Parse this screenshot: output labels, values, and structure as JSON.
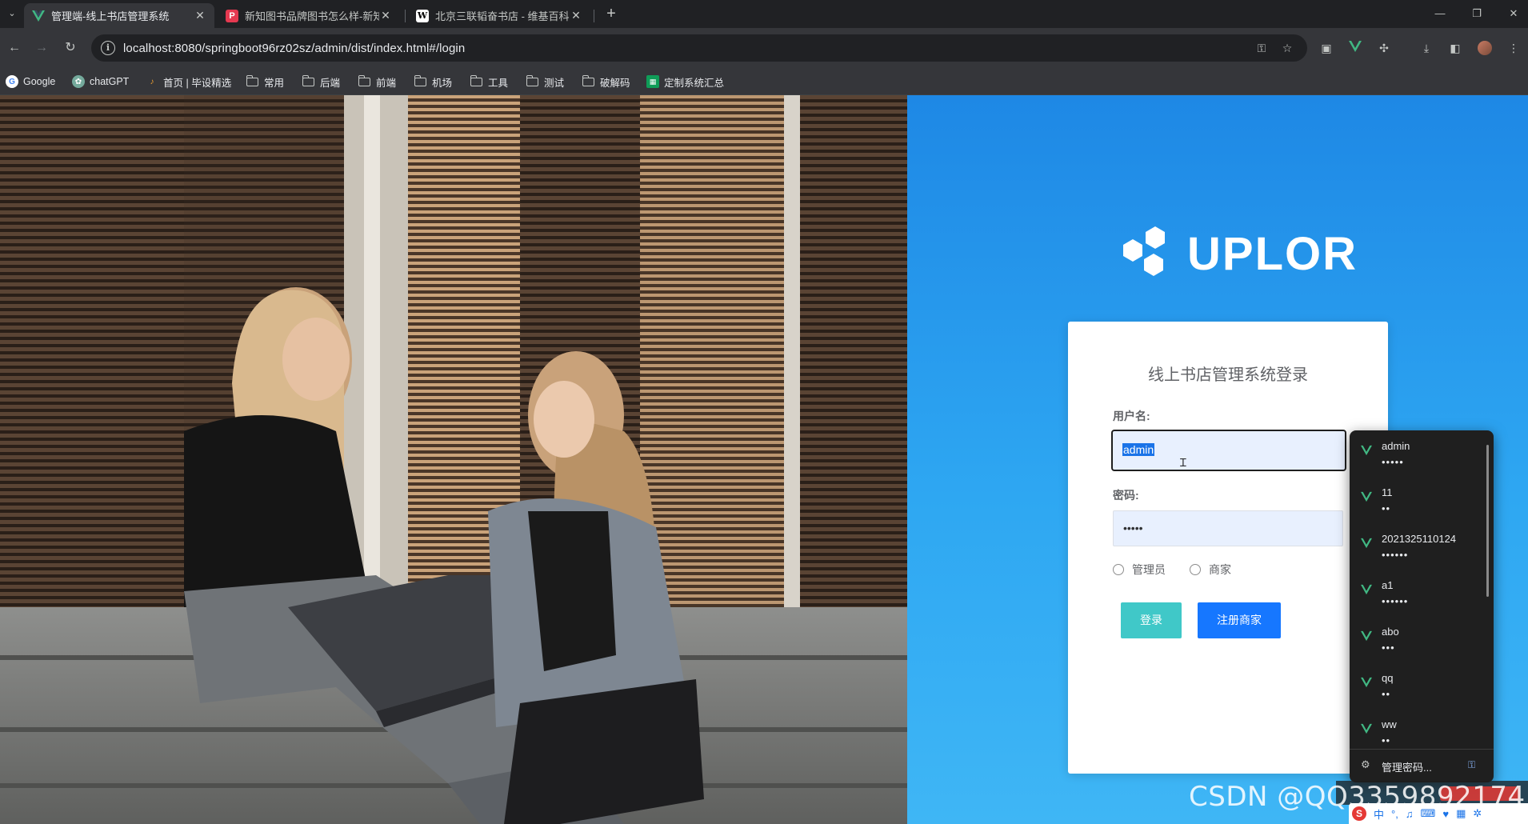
{
  "tabs": [
    {
      "title": "管理端-线上书店管理系统",
      "icon": "vue-v-icon",
      "active": true
    },
    {
      "title": "新知图书品牌图书怎么样-新知",
      "icon": "p-icon",
      "active": false
    },
    {
      "title": "北京三联韬奋书店 - 维基百科,",
      "icon": "w-icon",
      "active": false
    }
  ],
  "toolbar": {
    "url": "localhost:8080/springboot96rz02sz/admin/dist/index.html#/login"
  },
  "bookmarks": [
    {
      "label": "Google",
      "icon": "google-icon"
    },
    {
      "label": "chatGPT",
      "icon": "chatgpt-icon"
    },
    {
      "label": "首页 | 毕设精选",
      "icon": "site-icon"
    },
    {
      "label": "常用",
      "icon": "folder-icon"
    },
    {
      "label": "后端",
      "icon": "folder-icon"
    },
    {
      "label": "前端",
      "icon": "folder-icon"
    },
    {
      "label": "机场",
      "icon": "folder-icon"
    },
    {
      "label": "工具",
      "icon": "folder-icon"
    },
    {
      "label": "测试",
      "icon": "folder-icon"
    },
    {
      "label": "破解码",
      "icon": "folder-icon"
    },
    {
      "label": "定制系统汇总",
      "icon": "sheet-icon"
    }
  ],
  "logo": {
    "text": "UPLOR"
  },
  "login": {
    "title": "线上书店管理系统登录",
    "username_label": "用户名:",
    "username_value": "admin",
    "password_label": "密码:",
    "password_value": "•••••",
    "roles": [
      "管理员",
      "商家"
    ],
    "login_button": "登录",
    "register_button": "注册商家"
  },
  "autofill": {
    "items": [
      {
        "user": "admin",
        "pass": "•••••"
      },
      {
        "user": "11",
        "pass": "••"
      },
      {
        "user": "2021325110124",
        "pass": "••••••"
      },
      {
        "user": "a1",
        "pass": "••••••"
      },
      {
        "user": "abo",
        "pass": "•••"
      },
      {
        "user": "qq",
        "pass": "••"
      },
      {
        "user": "ww",
        "pass": "••"
      }
    ],
    "footer": "管理密码..."
  },
  "watermark": "CSDN @QQ3359892174",
  "ime": {
    "label": "中"
  },
  "colors": {
    "accent_blue": "#1677ff",
    "login_teal": "#40c8c8",
    "panel_gradient_top": "#1e88e5",
    "vue_green": "#41b883"
  }
}
